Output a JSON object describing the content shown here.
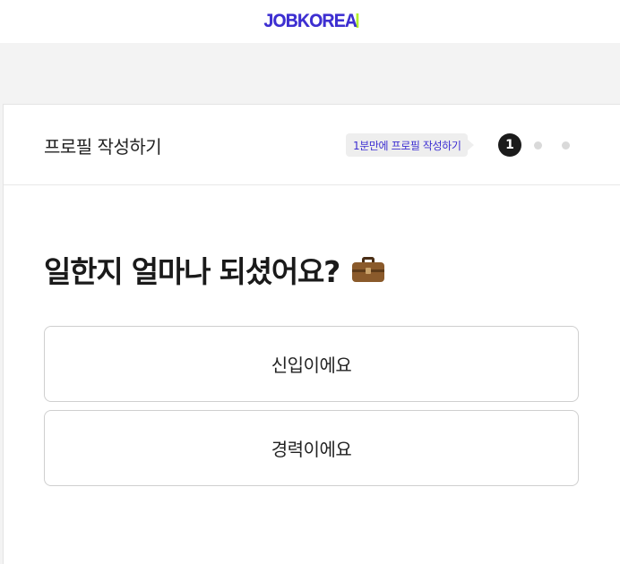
{
  "header": {
    "logo_main": "JOBKORE",
    "logo_accent": "A"
  },
  "card": {
    "title": "프로필 작성하기",
    "tooltip": "1분만에 프로필 작성하기",
    "steps": {
      "current": "1",
      "total": 3
    }
  },
  "question": {
    "text": "일한지 얼마나 되셨어요?",
    "icon": "briefcase-icon"
  },
  "options": [
    {
      "label": "신입이에요"
    },
    {
      "label": "경력이에요"
    }
  ],
  "colors": {
    "brand": "#3d2fd1",
    "accent": "#b4ef2b",
    "step_active": "#1b1b1b",
    "step_inactive": "#d9d9d9"
  }
}
